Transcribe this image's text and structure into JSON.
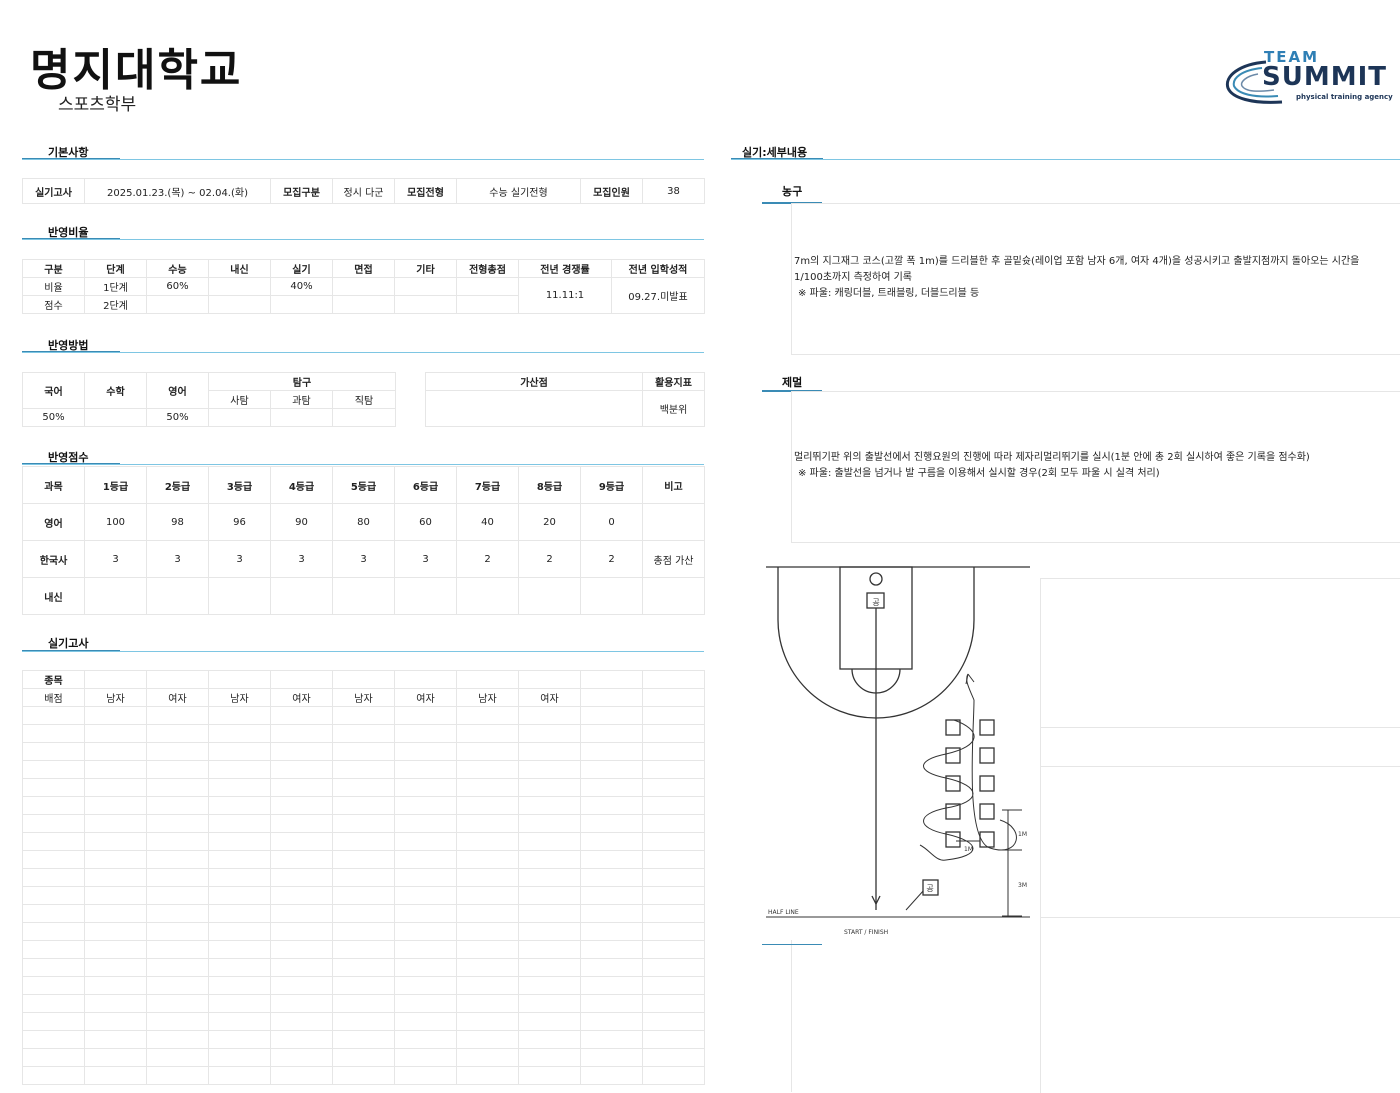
{
  "header": {
    "title": "명지대학교",
    "subtitle": "스포츠학부",
    "logo_top": "TEAM",
    "logo_main": "SUMMIT",
    "logo_sub": "physical training agency"
  },
  "basic": {
    "section": "기본사항",
    "exam_label": "실기고사",
    "exam_value": "2025.01.23.(목) ~ 02.04.(화)",
    "group_label": "모집구분",
    "group_value": "정시 다군",
    "type_label": "모집전형",
    "type_value": "수능 실기전형",
    "quota_label": "모집인원",
    "quota_value": "38"
  },
  "ratio": {
    "section": "반영비율",
    "headers": [
      "구분",
      "단계",
      "수능",
      "내신",
      "실기",
      "면접",
      "기타",
      "전형총점",
      "전년 경쟁률",
      "전년 입학성적"
    ],
    "row1": [
      "비율",
      "1단계",
      "60%",
      "",
      "40%",
      "",
      "",
      ""
    ],
    "row2": [
      "점수",
      "2단계",
      "",
      "",
      "",
      "",
      "",
      ""
    ],
    "competition": "11.11:1",
    "admission": "09.27.미발표"
  },
  "method": {
    "section": "반영방법",
    "kor": "국어",
    "math": "수학",
    "eng": "영어",
    "inquiry": "탐구",
    "social": "사탐",
    "science": "과탐",
    "job": "직탐",
    "bonus": "가산점",
    "index": "활용지표",
    "kor_val": "50%",
    "eng_val": "50%",
    "index_val": "백분위"
  },
  "score": {
    "section": "반영점수",
    "headers": [
      "과목",
      "1등급",
      "2등급",
      "3등급",
      "4등급",
      "5등급",
      "6등급",
      "7등급",
      "8등급",
      "9등급",
      "비고"
    ],
    "rows": [
      [
        "영어",
        "100",
        "98",
        "96",
        "90",
        "80",
        "60",
        "40",
        "20",
        "0",
        ""
      ],
      [
        "한국사",
        "3",
        "3",
        "3",
        "3",
        "3",
        "3",
        "2",
        "2",
        "2",
        "총점 가산"
      ],
      [
        "내신",
        "",
        "",
        "",
        "",
        "",
        "",
        "",
        "",
        "",
        ""
      ]
    ]
  },
  "practical": {
    "section": "실기고사",
    "event_label": "종목",
    "score_label": "배점",
    "cols": [
      "남자",
      "여자",
      "남자",
      "여자",
      "남자",
      "여자",
      "남자",
      "여자"
    ]
  },
  "detail": {
    "section": "실기:세부내용",
    "basketball": {
      "title": "농구",
      "line1": "7m의 지그재그 코스(고깔 폭 1m)를 드리블한 후 골밑슛(레이업 포함 남자 6개, 여자 4개)을 성공시키고 출발지점까지 돌아오는 시간을",
      "line2": "1/100초까지 측정하여 기록",
      "line3": "※ 파울: 캐링더블, 트래블링, 더블드리블 등"
    },
    "jump": {
      "title": "제멀",
      "line1": "멀리뛰기판 위의 출발선에서 진행요원의 진행에 따라 제자리멀리뛰기를 실시(1분 안에 총 2회 실시하여 좋은 기록을 점수화)",
      "line2": "※ 파울: 출발선을 넘거나 발 구름을 이용해서 실시할 경우(2회 모두 파울 시 실격 처리)"
    },
    "diagram": {
      "ball": "공",
      "half_line": "HALF LINE",
      "start": "START / FINISH",
      "d1": "1M",
      "d2": "1M",
      "d3": "3M"
    }
  }
}
